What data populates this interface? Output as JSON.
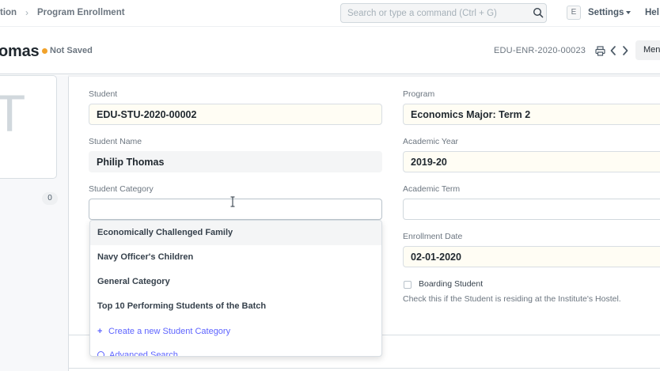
{
  "navbar": {
    "breadcrumb_prev": "tion",
    "breadcrumb_current": "Program Enrollment",
    "search_placeholder": "Search or type a command (Ctrl + G)",
    "avatar_letter": "E",
    "settings_label": "Settings",
    "help_label": "Hel"
  },
  "page_head": {
    "title": "omas",
    "status": "Not Saved",
    "doc_name": "EDU-ENR-2020-00023",
    "menu_label": "Men"
  },
  "sidebar": {
    "image_letter": "T",
    "count": "0"
  },
  "form": {
    "student_label": "Student",
    "student_value": "EDU-STU-2020-00002",
    "student_name_label": "Student Name",
    "student_name_value": "Philip Thomas",
    "student_category_label": "Student Category",
    "student_category_value": "",
    "program_label": "Program",
    "program_value": "Economics Major: Term 2",
    "academic_year_label": "Academic Year",
    "academic_year_value": "2019-20",
    "academic_term_label": "Academic Term",
    "academic_term_value": "",
    "enrollment_date_label": "Enrollment Date",
    "enrollment_date_value": "02-01-2020",
    "boarding_label": "Boarding Student",
    "boarding_help": "Check this if the Student is residing at the Institute's Hostel."
  },
  "dropdown": {
    "items": [
      "Economically Challenged Family",
      "Navy Officer's Children",
      "General Category",
      "Top 10 Performing Students of the Batch"
    ],
    "create_label": "Create a new Student Category",
    "advanced_label": "Advanced Search"
  },
  "colors": {
    "accent": "#5e64ff",
    "not_saved_dot": "#f1a22b"
  }
}
